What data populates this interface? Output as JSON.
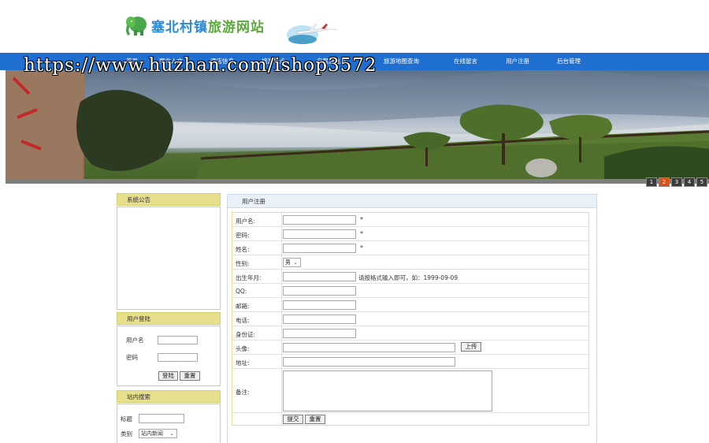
{
  "header": {
    "site_title_part1": "塞北村镇",
    "site_title_part2": "旅游网站"
  },
  "nav": {
    "items": [
      "首页",
      "塞北人文",
      "酒店信息",
      "旅游景点",
      "自驾游信息",
      "旅游地图查询",
      "在线留言",
      "用户注册",
      "后台管理"
    ]
  },
  "watermark": "https://www.huzhan.com/ishop3572",
  "banner": {
    "pages": [
      "1",
      "2",
      "3",
      "4",
      "5"
    ],
    "active_page": "2"
  },
  "sidebar": {
    "notice_title": "系统公告",
    "login_title": "用户登陆",
    "login_username_label": "用户名",
    "login_password_label": "密码",
    "login_button": "登陆",
    "reset_button": "重置",
    "search_title": "站内搜索",
    "search_title_label": "标题",
    "search_category_label": "类别",
    "search_category_value": "站内新闻"
  },
  "main": {
    "tab_title": "用户注册",
    "form": {
      "username_label": "用户名:",
      "password_label": "密码:",
      "name_label": "姓名:",
      "gender_label": "性别:",
      "gender_value": "男",
      "birth_label": "出生年月:",
      "birth_hint": "请按格式输入即可，如：1999-09-09",
      "qq_label": "QQ:",
      "email_label": "邮箱:",
      "phone_label": "电话:",
      "idcard_label": "身份证:",
      "avatar_label": "头像:",
      "upload_button": "上传",
      "address_label": "地址:",
      "remark_label": "备注:",
      "required_mark": "*",
      "submit_button": "提交",
      "reset_button": "重置"
    }
  },
  "colors": {
    "nav_bg": "#1e6fd0",
    "side_head_bg": "#e6df8c",
    "pager_active": "#e05010",
    "title_blue": "#2a8ad6",
    "title_green": "#5aa83a"
  }
}
